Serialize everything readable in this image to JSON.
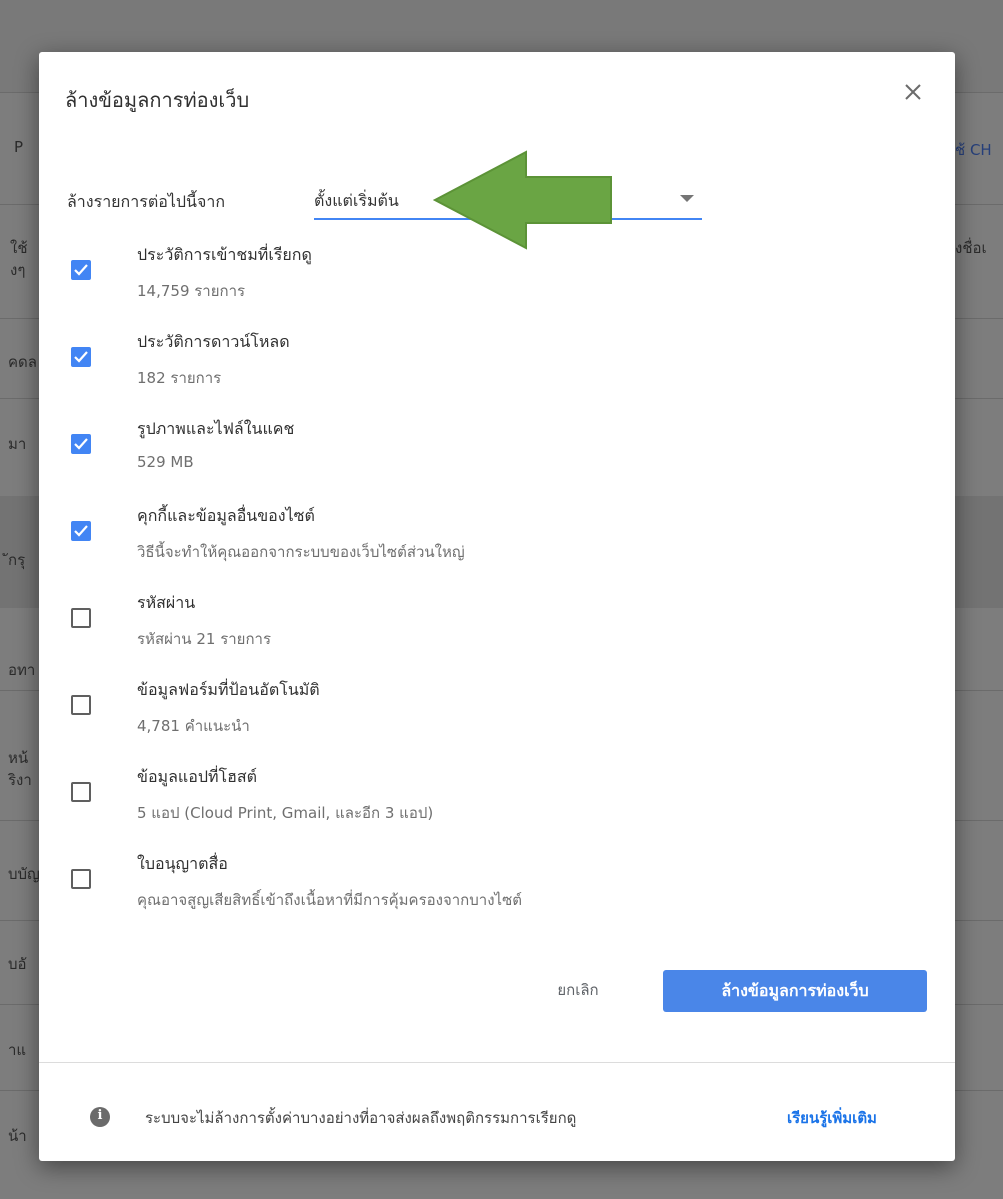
{
  "background": {
    "fragments": [
      {
        "text": "P"
      },
      {
        "text": "ช้ CH"
      },
      {
        "text": "ใช้"
      },
      {
        "text": "งๆ"
      },
      {
        "text": "งชื่อเ"
      },
      {
        "text": "คดล"
      },
      {
        "text": "มา"
      },
      {
        "text": "ักรุ"
      },
      {
        "text": "อทา"
      },
      {
        "text": "หน้"
      },
      {
        "text": "ริงา"
      },
      {
        "text": "บบัญ"
      },
      {
        "text": "บอั"
      },
      {
        "text": "าแ"
      },
      {
        "text": "น้า"
      }
    ]
  },
  "dialog": {
    "title": "ล้างข้อมูลการท่องเว็บ",
    "close_icon": "close-icon",
    "range_label": "ล้างรายการต่อไปนี้จาก",
    "range_value": "ตั้งแต่เริ่มต้น",
    "options": [
      {
        "title": "ประวัติการเข้าชมที่เรียกดู",
        "subtitle": "14,759 รายการ",
        "checked": true
      },
      {
        "title": "ประวัติการดาวน์โหลด",
        "subtitle": "182 รายการ",
        "checked": true
      },
      {
        "title": "รูปภาพและไฟล์ในแคช",
        "subtitle": "529 MB",
        "checked": true
      },
      {
        "title": "คุกกี้และข้อมูลอื่นของไซต์",
        "subtitle": "วิธีนี้จะทำให้คุณออกจากระบบของเว็บไซต์ส่วนใหญ่",
        "checked": true
      },
      {
        "title": "รหัสผ่าน",
        "subtitle": "รหัสผ่าน 21 รายการ",
        "checked": false
      },
      {
        "title": "ข้อมูลฟอร์มที่ป้อนอัตโนมัติ",
        "subtitle": "4,781 คำแนะนำ",
        "checked": false
      },
      {
        "title": "ข้อมูลแอปที่โฮสต์",
        "subtitle": "5 แอป (Cloud Print, Gmail, และอีก 3 แอป)",
        "checked": false
      },
      {
        "title": "ใบอนุญาตสื่อ",
        "subtitle": "คุณอาจสูญเสียสิทธิ์เข้าถึงเนื้อหาที่มีการคุ้มครองจากบางไซต์",
        "checked": false
      }
    ],
    "cancel_label": "ยกเลิก",
    "confirm_label": "ล้างข้อมูลการท่องเว็บ",
    "footer_text": "ระบบจะไม่ล้างการตั้งค่าบางอย่างที่อาจส่งผลถึงพฤติกรรมการเรียกดู",
    "footer_link": "เรียนรู้เพิ่มเติม"
  },
  "colors": {
    "accent": "#4285f4",
    "annotation_arrow": "#6aa544"
  }
}
